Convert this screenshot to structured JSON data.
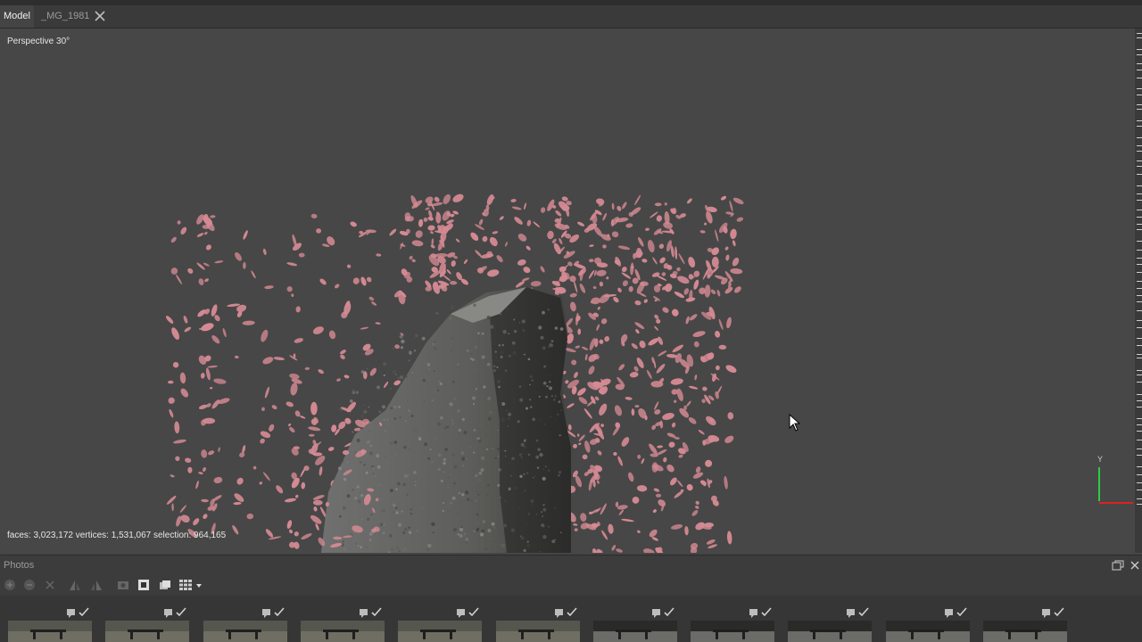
{
  "tabs": {
    "model": "Model",
    "photo": "_MG_1981"
  },
  "viewport": {
    "view_label": "Perspective 30°",
    "stats": "faces: 3,023,172 vertices: 1,531,067 selection: 964,165",
    "axis_label": "Y"
  },
  "photos_panel": {
    "title": "Photos"
  },
  "colors": {
    "selection": "#d58a93",
    "background": "#474747",
    "axis_y": "#2ecc40",
    "axis_x": "#e02020"
  },
  "thumbnails": [
    {
      "name": "thumb-1"
    },
    {
      "name": "thumb-2"
    },
    {
      "name": "thumb-3"
    },
    {
      "name": "thumb-4"
    },
    {
      "name": "thumb-5"
    },
    {
      "name": "thumb-6"
    },
    {
      "name": "thumb-7"
    },
    {
      "name": "thumb-8"
    },
    {
      "name": "thumb-9"
    },
    {
      "name": "thumb-10"
    },
    {
      "name": "thumb-11"
    }
  ]
}
